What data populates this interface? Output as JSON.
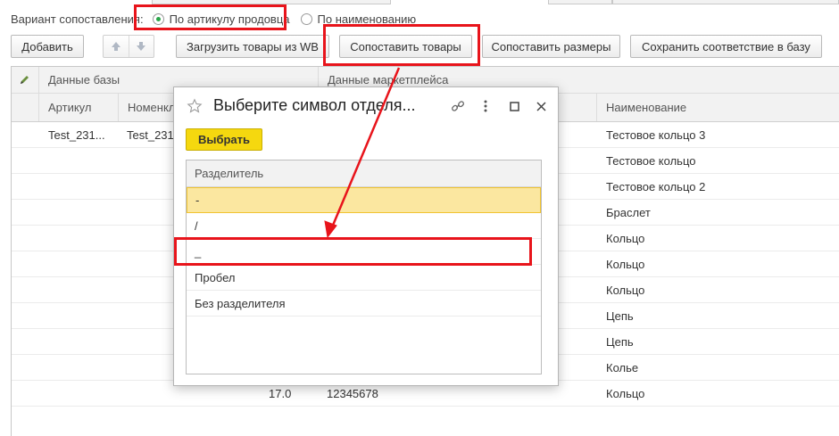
{
  "top": {
    "variant_label": "Вариант сопоставления:",
    "options": [
      {
        "label": "По артикулу продовца",
        "selected": true
      },
      {
        "label": "По наименованию",
        "selected": false
      }
    ]
  },
  "toolbar": {
    "add": "Добавить",
    "load_wb": "Загрузить товары из WB",
    "match_goods": "Сопоставить товары",
    "match_sizes": "Сопоставить размеры",
    "save_match": "Сохранить соответствие в базу"
  },
  "grid": {
    "group_base": "Данные базы",
    "group_market": "Данные маркетплейса",
    "col_article": "Артикул",
    "col_nomenclature": "Номенкл",
    "col_name": "Наименование",
    "rows": [
      {
        "article": "Test_231...",
        "nomenclature": "Test_231",
        "num": "",
        "code": "",
        "name": "Тестовое кольцо 3"
      },
      {
        "article": "",
        "nomenclature": "",
        "num": "",
        "code": "",
        "name": "Тестовое кольцо"
      },
      {
        "article": "",
        "nomenclature": "",
        "num": "",
        "code": "",
        "name": "Тестовое кольцо 2"
      },
      {
        "article": "",
        "nomenclature": "",
        "num": "",
        "code": "",
        "name": "Браслет"
      },
      {
        "article": "",
        "nomenclature": "",
        "num": "",
        "code": "",
        "name": "Кольцо"
      },
      {
        "article": "",
        "nomenclature": "",
        "num": "",
        "code": "",
        "name": "Кольцо"
      },
      {
        "article": "",
        "nomenclature": "",
        "num": "",
        "code": "",
        "name": "Кольцо"
      },
      {
        "article": "",
        "nomenclature": "",
        "num": "",
        "code": "",
        "name": "Цепь"
      },
      {
        "article": "",
        "nomenclature": "",
        "num": "",
        "code": "",
        "name": "Цепь"
      },
      {
        "article": "",
        "nomenclature": "",
        "num": "",
        "code": "",
        "name": "Колье"
      },
      {
        "article": "",
        "nomenclature": "",
        "num": "17.0",
        "code": "12345678",
        "name": "Кольцо"
      }
    ]
  },
  "modal": {
    "title": "Выберите символ отделя...",
    "choose_button": "Выбрать",
    "column": "Разделитель",
    "items": [
      {
        "label": "-",
        "selected": true
      },
      {
        "label": "/",
        "selected": false
      },
      {
        "label": "_",
        "selected": false
      },
      {
        "label": "Пробел",
        "selected": false
      },
      {
        "label": "Без разделителя",
        "selected": false
      }
    ]
  },
  "colors": {
    "accent_yellow": "#f5d80f",
    "highlight_red": "#e8141b",
    "radio_green": "#2aa64a",
    "selected_row": "#fbe7a0"
  },
  "icons": [
    "pencil-icon",
    "arrow-up-icon",
    "arrow-down-icon",
    "star-icon",
    "link-icon",
    "more-icon",
    "maximize-icon",
    "close-icon"
  ]
}
